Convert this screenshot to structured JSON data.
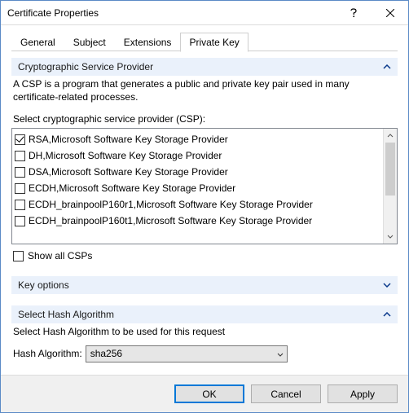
{
  "window": {
    "title": "Certificate Properties"
  },
  "tabs": {
    "items": [
      {
        "label": "General"
      },
      {
        "label": "Subject"
      },
      {
        "label": "Extensions"
      },
      {
        "label": "Private Key"
      }
    ]
  },
  "csp": {
    "header": "Cryptographic Service Provider",
    "desc": "A CSP is a program that generates a public and private key pair used in many certificate-related processes.",
    "select_label": "Select cryptographic service provider (CSP):",
    "show_all_label": "Show all CSPs",
    "show_all_checked": false,
    "providers": [
      {
        "label": "RSA,Microsoft Software Key Storage Provider",
        "checked": true
      },
      {
        "label": "DH,Microsoft Software Key Storage Provider",
        "checked": false
      },
      {
        "label": "DSA,Microsoft Software Key Storage Provider",
        "checked": false
      },
      {
        "label": "ECDH,Microsoft Software Key Storage Provider",
        "checked": false
      },
      {
        "label": "ECDH_brainpoolP160r1,Microsoft Software Key Storage Provider",
        "checked": false
      },
      {
        "label": "ECDH_brainpoolP160t1,Microsoft Software Key Storage Provider",
        "checked": false
      }
    ]
  },
  "key_options": {
    "header": "Key options"
  },
  "hash": {
    "header": "Select Hash Algorithm",
    "desc": "Select Hash Algorithm to be used for this request",
    "label": "Hash Algorithm:",
    "value": "sha256"
  },
  "buttons": {
    "ok": "OK",
    "cancel": "Cancel",
    "apply": "Apply"
  }
}
